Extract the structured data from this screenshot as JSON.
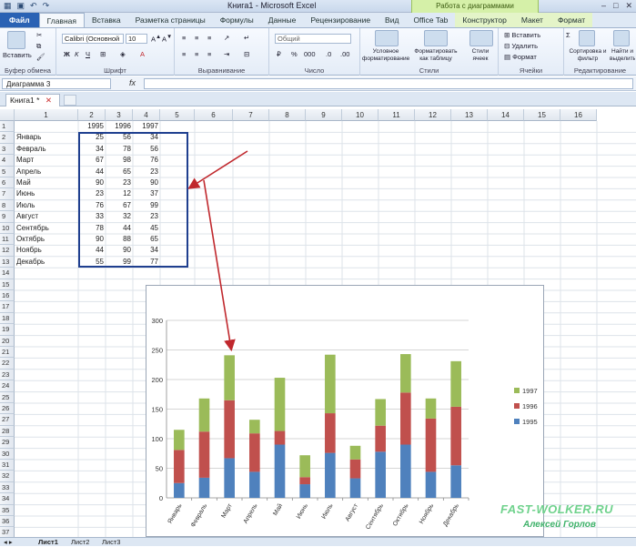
{
  "window": {
    "title": "Книга1 - Microsoft Excel",
    "context_group": "Работа с диаграммами"
  },
  "ribbon_tabs": [
    "Файл",
    "Главная",
    "Вставка",
    "Разметка страницы",
    "Формулы",
    "Данные",
    "Рецензирование",
    "Вид",
    "Office Tab",
    "Конструктор",
    "Макет",
    "Формат"
  ],
  "ribbon": {
    "paste_label": "Вставить",
    "clipboard_label": "Буфер обмена",
    "font_name": "Calibri (Основной",
    "font_size": "10",
    "font_label": "Шрифт",
    "align_label": "Выравнивание",
    "number_format": "Общий",
    "number_label": "Число",
    "cond_format": "Условное форматирование",
    "format_table": "Форматировать как таблицу",
    "cell_styles": "Стили ячеек",
    "styles_label": "Стили",
    "insert": "Вставить",
    "delete": "Удалить",
    "format": "Формат",
    "cells_label": "Ячейки",
    "sort_filter": "Сортировка и фильтр",
    "find_select": "Найти и выделить",
    "edit_label": "Редактирование"
  },
  "formula_bar": {
    "name_box": "Диаграмма 3",
    "fx": "fx",
    "formula": ""
  },
  "doc_tab": "Книга1 *",
  "columns": [
    "1",
    "2",
    "3",
    "4",
    "5",
    "6",
    "7",
    "8",
    "9",
    "10",
    "11",
    "12",
    "13",
    "14",
    "15",
    "16"
  ],
  "rows": [
    "1",
    "2",
    "3",
    "4",
    "5",
    "6",
    "7",
    "8",
    "9",
    "10",
    "11",
    "12",
    "13",
    "14",
    "15",
    "16",
    "17",
    "18",
    "19",
    "20",
    "21",
    "22",
    "23",
    "24",
    "25",
    "26",
    "27",
    "28",
    "29",
    "30",
    "31",
    "32",
    "33",
    "34",
    "35",
    "36",
    "37"
  ],
  "table": {
    "years": [
      "1995",
      "1996",
      "1997"
    ],
    "months": [
      "Январь",
      "Февраль",
      "Март",
      "Апрель",
      "Май",
      "Июнь",
      "Июль",
      "Август",
      "Сентябрь",
      "Октябрь",
      "Ноябрь",
      "Декабрь"
    ],
    "values": [
      [
        25,
        56,
        34
      ],
      [
        34,
        78,
        56
      ],
      [
        67,
        98,
        76
      ],
      [
        44,
        65,
        23
      ],
      [
        90,
        23,
        90
      ],
      [
        23,
        12,
        37
      ],
      [
        76,
        67,
        99
      ],
      [
        33,
        32,
        23
      ],
      [
        78,
        44,
        45
      ],
      [
        90,
        88,
        65
      ],
      [
        44,
        90,
        34
      ],
      [
        55,
        99,
        77
      ]
    ]
  },
  "sheet_tabs": [
    "Лист1",
    "Лист2",
    "Лист3"
  ],
  "watermark": {
    "line1": "FAST-WOLKER.RU",
    "line2": "Алексей Горлов"
  },
  "chart_data": {
    "type": "bar",
    "stacked": true,
    "categories": [
      "Январь",
      "Февраль",
      "Март",
      "Апрель",
      "Май",
      "Июнь",
      "Июль",
      "Август",
      "Сентябрь",
      "Октябрь",
      "Ноябрь",
      "Декабрь"
    ],
    "series": [
      {
        "name": "1995",
        "values": [
          25,
          34,
          67,
          44,
          90,
          23,
          76,
          33,
          78,
          90,
          44,
          55
        ],
        "color": "#4f81bd"
      },
      {
        "name": "1996",
        "values": [
          56,
          78,
          98,
          65,
          23,
          12,
          67,
          32,
          44,
          88,
          90,
          99
        ],
        "color": "#c0504d"
      },
      {
        "name": "1997",
        "values": [
          34,
          56,
          76,
          23,
          90,
          37,
          99,
          23,
          45,
          65,
          34,
          77
        ],
        "color": "#9bbb59"
      }
    ],
    "yticks": [
      "0",
      "50",
      "100",
      "150",
      "200",
      "250",
      "300"
    ],
    "ylim": [
      0,
      300
    ],
    "grid": true,
    "legend_position": "right"
  }
}
